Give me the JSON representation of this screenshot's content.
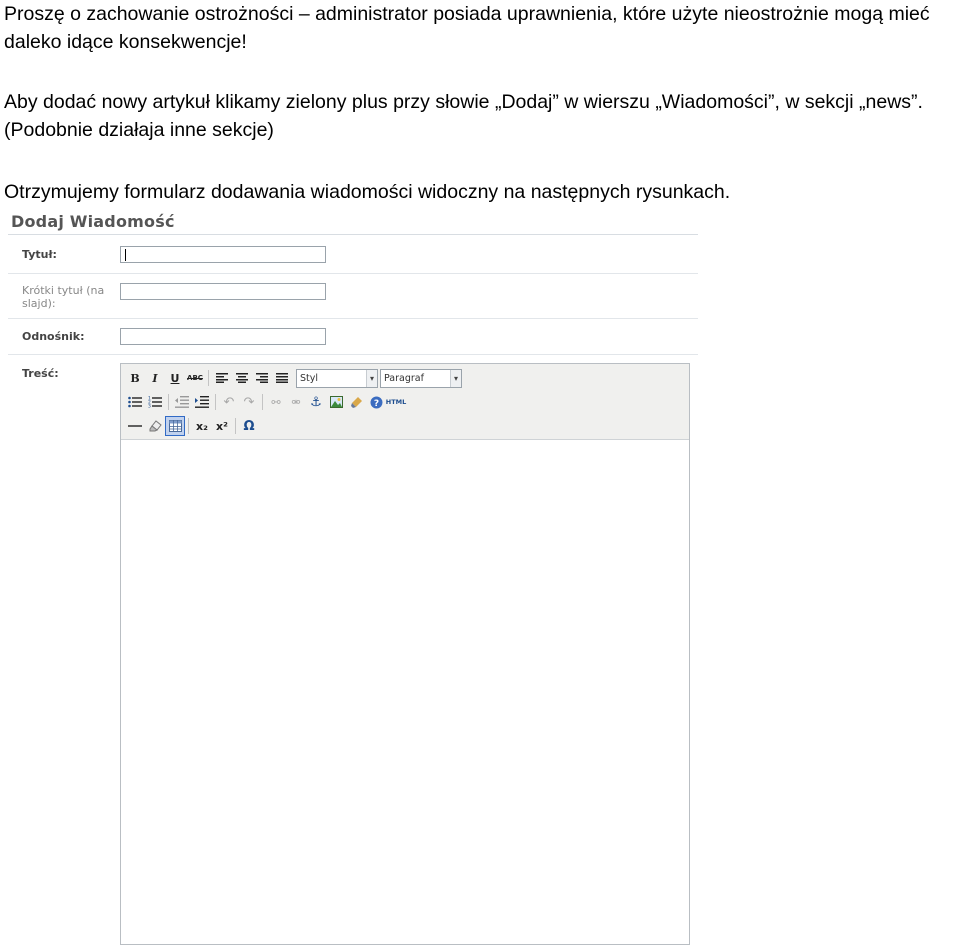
{
  "document": {
    "warning": "Proszę o zachowanie ostrożności – administrator posiada uprawnienia, które użyte nieostrożnie mogą mieć daleko idące konsekwencje!",
    "instruction": "Aby dodać nowy artykuł klikamy zielony plus przy słowie „Dodaj” w wierszu „Wiadomości”, w sekcji „news”. (Podobnie działaja inne sekcje)",
    "result": "Otrzymujemy formularz dodawania wiadomości widoczny na następnych  rysunkach."
  },
  "form": {
    "title": "Dodaj Wiadomość",
    "fields": {
      "title_label": "Tytuł:",
      "title_value": "",
      "short_title_label": "Krótki tytuł (na slajd):",
      "short_title_value": "",
      "link_label": "Odnośnik:",
      "link_value": "",
      "content_label": "Treść:"
    },
    "editor": {
      "style_select": "Styl",
      "format_select": "Paragraf",
      "toolbar_icons": {
        "row1": [
          "bold-icon",
          "italic-icon",
          "underline-icon",
          "strikethrough-icon",
          "align-left-icon",
          "align-center-icon",
          "align-right-icon",
          "align-justify-icon"
        ],
        "row2": [
          "bullet-list-icon",
          "numbered-list-icon",
          "outdent-icon",
          "indent-icon",
          "undo-icon",
          "redo-icon",
          "link-icon",
          "unlink-icon",
          "anchor-icon",
          "image-icon",
          "cleanup-icon",
          "help-icon",
          "html-icon"
        ],
        "row3": [
          "horizontal-rule-icon",
          "remove-format-icon",
          "table-icon",
          "subscript-icon",
          "superscript-icon",
          "special-char-icon"
        ]
      },
      "labels": {
        "bold": "B",
        "italic": "I",
        "underline": "U",
        "strike": "ABC",
        "html": "HTML",
        "sub": "x₂",
        "sup": "x²",
        "omega": "Ω"
      }
    }
  }
}
